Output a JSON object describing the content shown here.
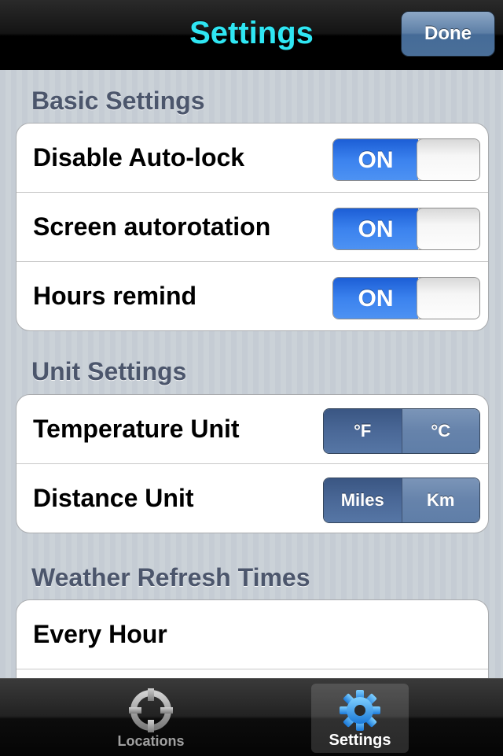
{
  "navbar": {
    "title": "Settings",
    "done_label": "Done"
  },
  "sections": {
    "basic": {
      "header": "Basic Settings",
      "rows": [
        {
          "label": "Disable Auto-lock",
          "toggle": "ON"
        },
        {
          "label": "Screen autorotation",
          "toggle": "ON"
        },
        {
          "label": "Hours remind",
          "toggle": "ON"
        }
      ]
    },
    "units": {
      "header": "Unit Settings",
      "rows": [
        {
          "label": "Temperature Unit",
          "options": [
            "°F",
            "°C"
          ],
          "selected": "°F"
        },
        {
          "label": "Distance Unit",
          "options": [
            "Miles",
            "Km"
          ],
          "selected": "Miles"
        }
      ]
    },
    "refresh": {
      "header": "Weather Refresh Times",
      "rows": [
        {
          "label": "Every Hour"
        }
      ]
    }
  },
  "tabbar": {
    "tabs": [
      {
        "label": "Locations",
        "icon": "crosshair-icon",
        "active": false
      },
      {
        "label": "Settings",
        "icon": "gear-icon",
        "active": true
      }
    ]
  },
  "colors": {
    "title": "#2fe6f3",
    "toggle_on": "#3b82ee",
    "segment_selected": "#4a6897",
    "gear_icon": "#2fa6f0"
  }
}
